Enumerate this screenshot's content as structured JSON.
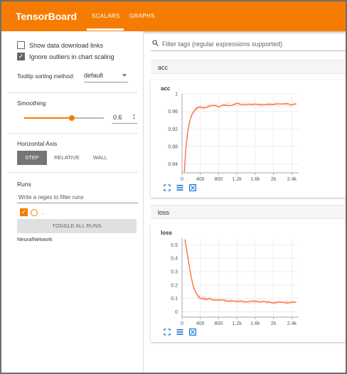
{
  "app": {
    "title": "TensorBoard"
  },
  "tabs": [
    {
      "label": "SCALARS",
      "active": true
    },
    {
      "label": "GRAPHS",
      "active": false
    }
  ],
  "colors": {
    "accent": "#f57c00",
    "line": "#ff7043",
    "line_light": "#ffccbc"
  },
  "sidebar": {
    "show_download_links": {
      "label": "Show data download links",
      "checked": false
    },
    "ignore_outliers": {
      "label": "Ignore outliers in chart scaling",
      "checked": true
    },
    "tooltip_sorting": {
      "label": "Tooltip sorting method:",
      "value": "default"
    },
    "smoothing": {
      "title": "Smoothing",
      "value": "0.6",
      "fraction": 0.6
    },
    "horizontal_axis": {
      "title": "Horizontal Axis",
      "options": [
        "STEP",
        "RELATIVE",
        "WALL"
      ],
      "selected": "STEP"
    },
    "runs": {
      "title": "Runs",
      "filter_placeholder": "Write a regex to filter runs",
      "items": [
        {
          "label": ".",
          "checked": true
        }
      ],
      "toggle_label": "TOGGLE ALL RUNS",
      "run_name": "NeuralNetwork"
    }
  },
  "main": {
    "filter_placeholder": "Filter tags (regular expressions supported)",
    "groups": [
      {
        "name": "acc"
      },
      {
        "name": "loss"
      }
    ]
  },
  "chart_data": [
    {
      "type": "line",
      "title": "acc",
      "x_ticks": [
        "0",
        "400",
        "800",
        "1.2k",
        "1.6k",
        "2k",
        "2.4k"
      ],
      "y_ticks": [
        "0.84",
        "0.88",
        "0.92",
        "0.96",
        "1"
      ],
      "xlim": [
        0,
        2550
      ],
      "ylim": [
        0.82,
        1.0
      ],
      "series": [
        {
          "x": [
            50,
            80,
            120,
            160,
            200,
            250,
            300,
            350,
            400,
            450,
            500,
            600,
            700,
            800,
            900,
            1000,
            1100,
            1200,
            1300,
            1400,
            1500,
            1600,
            1700,
            1800,
            1900,
            2000,
            2100,
            2200,
            2300,
            2400,
            2500
          ],
          "y": [
            0.82,
            0.87,
            0.91,
            0.935,
            0.95,
            0.958,
            0.965,
            0.968,
            0.97,
            0.968,
            0.97,
            0.972,
            0.975,
            0.972,
            0.976,
            0.975,
            0.974,
            0.977,
            0.976,
            0.975,
            0.977,
            0.976,
            0.975,
            0.976,
            0.976,
            0.977,
            0.976,
            0.975,
            0.977,
            0.976,
            0.977
          ]
        }
      ]
    },
    {
      "type": "line",
      "title": "loss",
      "x_ticks": [
        "0",
        "400",
        "800",
        "1.2k",
        "1.6k",
        "2k",
        "2.4k"
      ],
      "y_ticks": [
        "0",
        "0.1",
        "0.2",
        "0.3",
        "0.4",
        "0.5"
      ],
      "xlim": [
        0,
        2550
      ],
      "ylim": [
        -0.04,
        0.55
      ],
      "series": [
        {
          "x": [
            60,
            100,
            150,
            200,
            250,
            300,
            350,
            400,
            450,
            500,
            600,
            700,
            800,
            900,
            1000,
            1100,
            1200,
            1300,
            1400,
            1500,
            1600,
            1700,
            1800,
            1900,
            2000,
            2100,
            2200,
            2300,
            2400,
            2500
          ],
          "y": [
            0.54,
            0.47,
            0.36,
            0.26,
            0.19,
            0.14,
            0.115,
            0.105,
            0.1,
            0.098,
            0.095,
            0.09,
            0.088,
            0.085,
            0.083,
            0.082,
            0.08,
            0.078,
            0.077,
            0.076,
            0.075,
            0.074,
            0.073,
            0.073,
            0.072,
            0.072,
            0.071,
            0.071,
            0.07,
            0.07
          ]
        }
      ]
    }
  ]
}
